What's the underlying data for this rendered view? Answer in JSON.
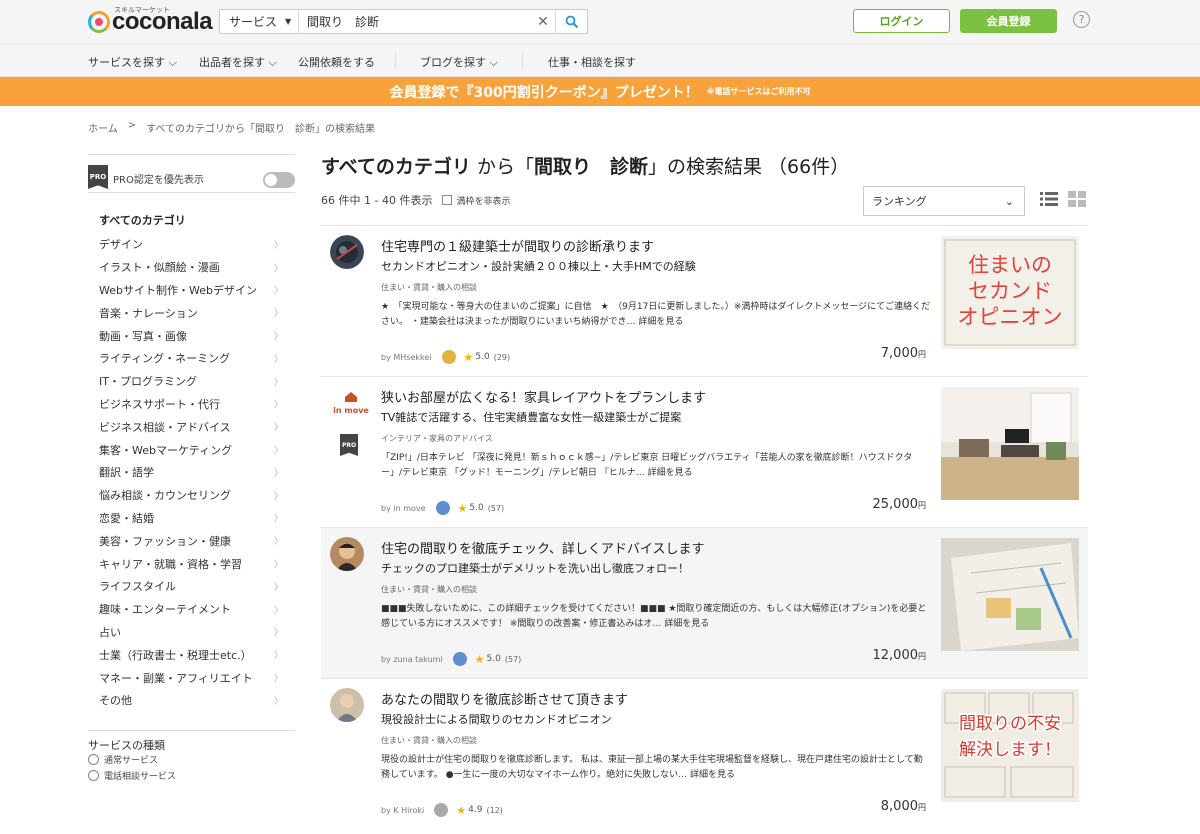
{
  "header": {
    "logo_text": "coconala",
    "logo_sub": "スキルマーケット",
    "search_category": "サービス",
    "search_value": "間取り　診断",
    "login_label": "ログイン",
    "register_label": "会員登録",
    "help_label": "?"
  },
  "nav": [
    "サービスを探す",
    "出品者を探す",
    "公開依頼をする",
    "ブログを探す",
    "仕事・相談を探す"
  ],
  "banner": {
    "main": "会員登録で『300円割引クーポン』プレゼント！",
    "note": "※電話サービスはご利用不可"
  },
  "breadcrumb": [
    "ホーム",
    ">",
    "すべてのカテゴリから「間取り　診断」の検索結果"
  ],
  "sidebar": {
    "pro_label": "PRO認定を優先表示",
    "pro_badge": "PRO",
    "all_categories": "すべてのカテゴリ",
    "categories": [
      "デザイン",
      "イラスト・似顔絵・漫画",
      "Webサイト制作・Webデザイン",
      "音楽・ナレーション",
      "動画・写真・画像",
      "ライティング・ネーミング",
      "IT・プログラミング",
      "ビジネスサポート・代行",
      "ビジネス相談・アドバイス",
      "集客・Webマーケティング",
      "翻訳・語学",
      "悩み相談・カウンセリング",
      "恋愛・結婚",
      "美容・ファッション・健康",
      "キャリア・就職・資格・学習",
      "ライフスタイル",
      "趣味・エンターテイメント",
      "占い",
      "士業（行政書士・税理士etc.）",
      "マネー・副業・アフィリエイト",
      "その他"
    ],
    "service_type_title": "サービスの種類",
    "service_types": [
      "通常サービス",
      "電話相談サービス"
    ]
  },
  "results": {
    "title_prefix": "すべてのカテゴリ",
    "title_from": " から「",
    "title_query": "間取り　診断",
    "title_suffix": "」の検索結果 （66件）",
    "count_text": "66 件中 1 - 40 件表示",
    "hide_full_label": "満枠を非表示",
    "sort_value": "ランキング",
    "items": [
      {
        "title": "住宅専門の１級建築士が間取りの診断承ります",
        "subtitle": "セカンドオピニオン・設計実績２００棟以上・大手HMでの経験",
        "category": "住まい・賃貸・購入の相談",
        "description": "★　「実現可能な・等身大の住まいのご提案」に自信　★　（9月17日に更新しました。）※満枠時はダイレクトメッセージにてご連絡ください。 ・建築会社は決まったが間取りにいまいち納得ができ…",
        "more": "詳細を見る",
        "seller": "by MHsekkei",
        "rating": "5.0",
        "reviews": "(29)",
        "price": "7,000",
        "yen": "円",
        "thumb_text": "住まいの\nセカンド\nオピニオン"
      },
      {
        "title": "狭いお部屋が広くなる！家具レイアウトをプランします",
        "subtitle": "TV雑誌で活躍する、住宅実績豊富な女性一級建築士がご提案",
        "category": "インテリア・家具のアドバイス",
        "description": "「ZIP!」/日本テレビ 「深夜に発見！新ｓｈｏｃｋ感~」/テレビ東京 日曜ビッグバラエティ「芸能人の家を徹底診断！ハウスドクター」/テレビ東京 「グッド！モーニング」/テレビ朝日 『ヒルナ…",
        "more": "詳細を見る",
        "seller": "by in move",
        "rating": "5.0",
        "reviews": "(57)",
        "price": "25,000",
        "yen": "円",
        "avatar_text": "in move"
      },
      {
        "title": "住宅の間取りを徹底チェック、詳しくアドバイスします",
        "subtitle": "チェックのプロ建築士がデメリットを洗い出し徹底フォロー！",
        "category": "住まい・賃貸・購入の相談",
        "description": "■■■失敗しないために、この詳細チェックを受けてください！■■■ ★間取り確定間近の方、もしくは大幅修正(オプション)を必要と感じている方にオススメです！ ※間取りの改善案・修正書込みはオ…",
        "more": "詳細を見る",
        "seller": "by zuna takumi",
        "rating": "5.0",
        "reviews": "(57)",
        "price": "12,000",
        "yen": "円"
      },
      {
        "title": "あなたの間取りを徹底診断させて頂きます",
        "subtitle": "現役設計士による間取りのセカンドオピニオン",
        "category": "住まい・賃貸・購入の相談",
        "description": "現役の設計士が住宅の間取りを徹底診断します。 私は、東証一部上場の某大手住宅現場監督を経験し、現在戸建住宅の設計士として勤務しています。 ●一生に一度の大切なマイホーム作り。絶対に失敗しない…",
        "more": "詳細を見る",
        "seller": "by K Hiroki",
        "rating": "4.9",
        "reviews": "(12)",
        "price": "8,000",
        "yen": "円",
        "thumb_text": "間取りの不安\n解決します！"
      }
    ]
  }
}
